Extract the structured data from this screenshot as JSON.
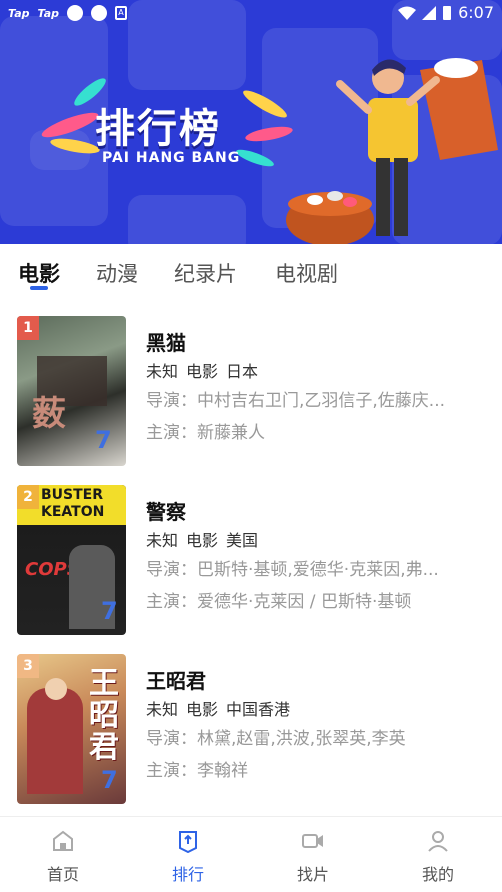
{
  "status_bar": {
    "left_labels": [
      "Tap",
      "Tap"
    ],
    "time": "6:07"
  },
  "banner": {
    "logo_title": "排行榜",
    "logo_subtitle": "PAI HANG BANG"
  },
  "tabs": [
    {
      "label": "电影",
      "active": true
    },
    {
      "label": "动漫",
      "active": false
    },
    {
      "label": "纪录片",
      "active": false
    },
    {
      "label": "电视剧",
      "active": false
    }
  ],
  "items": [
    {
      "rank": "1",
      "rank_color": "#e35b4c",
      "title": "黑猫",
      "meta": [
        "未知",
        "电影",
        "日本"
      ],
      "director": "导演：中村吉右卫门,乙羽信子,佐藤庆...",
      "cast": "主演：新藤兼人"
    },
    {
      "rank": "2",
      "rank_color": "#f0b33b",
      "title": "警察",
      "meta": [
        "未知",
        "电影",
        "美国"
      ],
      "director": "导演：巴斯特·基顿,爱德华·克莱因,弗...",
      "cast": "主演：爱德华·克莱因 / 巴斯特·基顿"
    },
    {
      "rank": "3",
      "rank_color": "#f0b884",
      "title": "王昭君",
      "meta": [
        "未知",
        "电影",
        "中国香港"
      ],
      "director": "导演：林黛,赵雷,洪波,张翠英,李英",
      "cast": "主演：李翰祥"
    }
  ],
  "bottom_nav": [
    {
      "label": "首页",
      "icon": "home-icon",
      "active": false
    },
    {
      "label": "排行",
      "icon": "ranking-icon",
      "active": true
    },
    {
      "label": "找片",
      "icon": "video-camera-icon",
      "active": false
    },
    {
      "label": "我的",
      "icon": "user-icon",
      "active": false
    }
  ],
  "colors": {
    "banner_bg": "#2c3bd6",
    "accent": "#2e63e6"
  }
}
